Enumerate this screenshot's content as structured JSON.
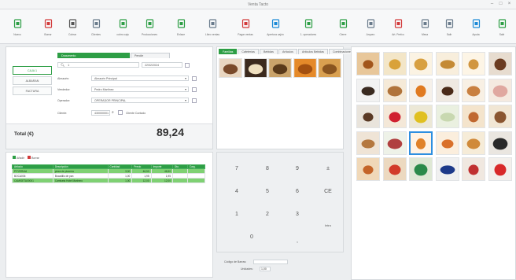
{
  "window": {
    "title": "Venta Tacto"
  },
  "toolbar": [
    {
      "label": "Nuevo",
      "icon": "new-document-icon",
      "color": "#2d9e45"
    },
    {
      "label": "Borrar",
      "icon": "delete-document-icon",
      "color": "#d23a3a"
    },
    {
      "label": "Cobrar",
      "icon": "print-icon",
      "color": "#555555"
    },
    {
      "label": "Clientes",
      "icon": "client-icon",
      "color": "#6a7b8c"
    },
    {
      "label": "cobro caja",
      "icon": "cash-icon",
      "color": "#2d9e45"
    },
    {
      "label": "Producciones",
      "icon": "production-icon",
      "color": "#2d9e45"
    },
    {
      "label": "Enlace",
      "icon": "link-icon",
      "color": "#2d9e45"
    },
    {
      "label": "Libro ventas",
      "icon": "sales-book-icon",
      "color": "#6a7b8c"
    },
    {
      "label": "Pagar ventas",
      "icon": "pay-icon",
      "color": "#d23a3a"
    },
    {
      "label": "Apertura cajón",
      "icon": "drawer-open-icon",
      "color": "#1d8ad6"
    },
    {
      "label": "1. operadores",
      "icon": "operator-icon",
      "color": "#2d9e45"
    },
    {
      "label": "Cierre",
      "icon": "close-register-icon",
      "color": "#2d9e45"
    },
    {
      "label": "Arqueo",
      "icon": "audit-icon",
      "color": "#6a7b8c"
    },
    {
      "label": "Art. Prefco",
      "icon": "price-icon",
      "color": "#d23a3a"
    },
    {
      "label": "Mesa",
      "icon": "table-icon",
      "color": "#6a7b8c"
    },
    {
      "label": "Salir",
      "icon": "exit-icon",
      "color": "#6a7b8c"
    },
    {
      "label": "Ayuda",
      "icon": "help-icon",
      "color": "#1d8ad6"
    },
    {
      "label": "Salir",
      "icon": "logout-icon",
      "color": "#2d9e45"
    }
  ],
  "doc": {
    "tabs": [
      "Documento",
      "Pendie"
    ],
    "number": "1",
    "date": "22/02/2024",
    "side": [
      "CAJA 1",
      "ALBARAN",
      "FACTURA"
    ],
    "fields": [
      {
        "label": "Almacén:",
        "value": "Almacén Principal"
      },
      {
        "label": "Vendedor:",
        "value": "Pedro Martínez"
      },
      {
        "label": "Operador:",
        "value": "OPERADOR PRINCIPAL"
      }
    ],
    "client_label": "Cliente:",
    "client_code": "430000001",
    "client_name": "Cliente Contado",
    "total_label": "Total (€)",
    "total_value": "89,24"
  },
  "lines": {
    "toolbar": [
      "Añadir",
      "Borrar"
    ],
    "headers": [
      "Artículo",
      "Descripción",
      "Cantidad",
      "Precio",
      "Importe",
      "Dto.",
      "Carg."
    ],
    "rows": [
      {
        "code": "PITZERIA6",
        "desc": "pizza de pizzería",
        "qty": "3,00",
        "price": "46,50",
        "total": "46,50",
        "sel": true
      },
      {
        "code": "BOCA006",
        "desc": "Bocadillo de pan",
        "qty": "1,00",
        "price": "1,95",
        "total": "1,95",
        "sel": false
      },
      {
        "code": "CAMISETA00001",
        "desc": "Camiseta Hotel Marinero",
        "qty": "1,00",
        "price": "12,00",
        "total": "12,00",
        "sel": true
      }
    ]
  },
  "families": {
    "tabs": [
      "Familias",
      "Cafeterías",
      "Bebidas",
      "Artículos",
      "Artículos Bebidas",
      "Combinaciones"
    ]
  },
  "keypad": [
    "7",
    "8",
    "9",
    "±",
    "4",
    "5",
    "6",
    "CE",
    "1",
    "2",
    "3",
    "Intro",
    "0",
    ","
  ],
  "bottom": {
    "label1": "Código de Barras:",
    "label2": "Unidades:",
    "units": "1,00"
  },
  "colors": {
    "accent": "#2d9e45",
    "select": "#2e8fe0"
  }
}
